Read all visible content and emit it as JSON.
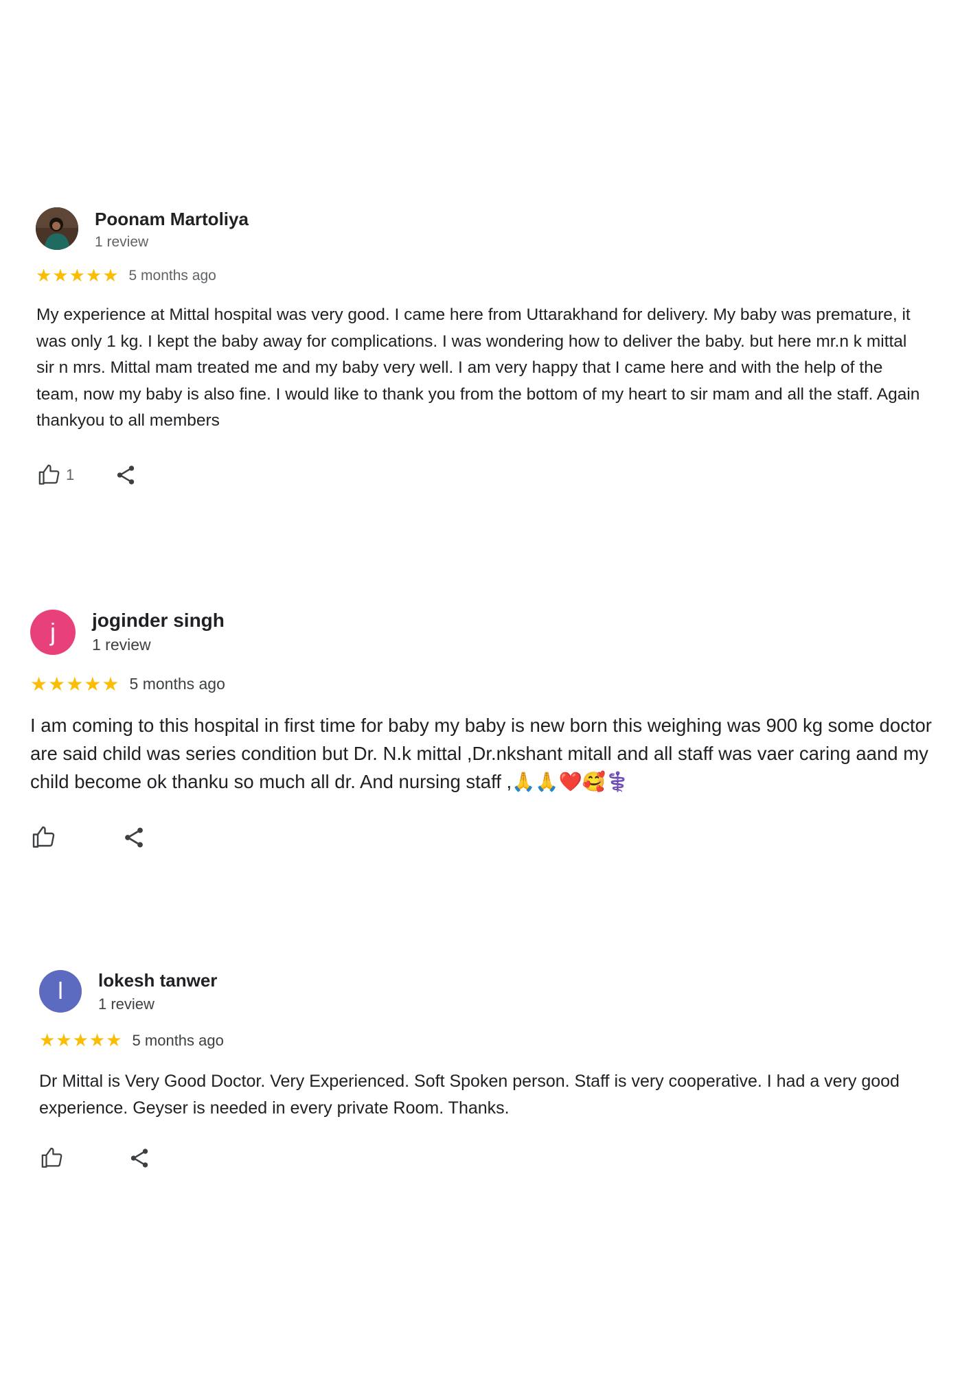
{
  "reviews": [
    {
      "name": "Poonam Martoliya",
      "review_count": "1 review",
      "avatar": {
        "type": "photo",
        "color": "#3b2a22"
      },
      "rating": 5,
      "stars": "★★★★★",
      "date": "5 months ago",
      "text": "My experience at Mittal hospital was very good. I came here from Uttarakhand for delivery. My baby was premature, it was only 1 kg. I kept the baby away for complications. I was wondering how to deliver the baby. but here mr.n k mittal sir n mrs. Mittal mam treated me and my baby very well. I am very happy that I came here and with the help of the team, now my baby is also fine. I would like to thank you from the bottom of my heart to sir mam and all the staff. Again thankyou to all members",
      "likes": "1",
      "like_icon": "thumbs-up-icon",
      "share_icon": "share-icon"
    },
    {
      "name": "joginder singh",
      "review_count": "1 review",
      "avatar": {
        "type": "letter",
        "letter": "j",
        "color": "#e8407a"
      },
      "rating": 5,
      "stars": "★★★★★",
      "date": "5 months ago",
      "text": "I am coming to this hospital in first time for baby my baby is new born this weighing was 900 kg some doctor are said child was series condition but Dr. N.k mittal ,Dr.nkshant mitall and all staff was vaer caring aand my child become ok thanku so much all dr. And nursing staff ,🙏🙏❤️🥰⚕️",
      "likes": "",
      "like_icon": "thumbs-up-icon",
      "share_icon": "share-icon"
    },
    {
      "name": "lokesh tanwer",
      "review_count": "1 review",
      "avatar": {
        "type": "letter",
        "letter": "l",
        "color": "#5c6bc0"
      },
      "rating": 5,
      "stars": "★★★★★",
      "date": "5 months ago",
      "text": "Dr Mittal is Very Good Doctor. Very Experienced. Soft Spoken person. Staff is very cooperative. I had a very good experience. Geyser is needed in every private Room. Thanks.",
      "likes": "",
      "like_icon": "thumbs-up-icon",
      "share_icon": "share-icon"
    }
  ]
}
